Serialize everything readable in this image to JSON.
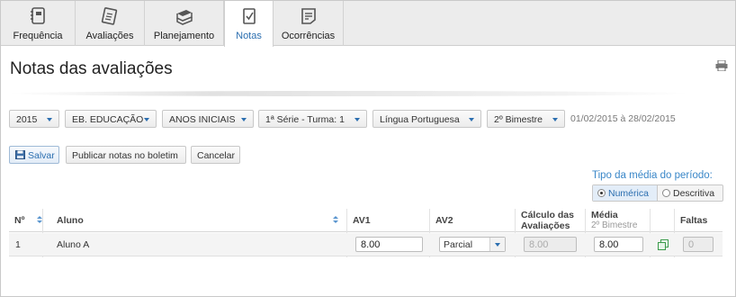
{
  "tabs": [
    {
      "label": "Frequência",
      "icon": "frequency-book-icon"
    },
    {
      "label": "Avaliações",
      "icon": "assessment-icon"
    },
    {
      "label": "Planejamento",
      "icon": "books-stack-icon"
    },
    {
      "label": "Notas",
      "icon": "grade-sheet-icon",
      "active": true
    },
    {
      "label": "Ocorrências",
      "icon": "occurrence-note-icon"
    }
  ],
  "page": {
    "title": "Notas das avaliações",
    "print_icon": "printer-icon"
  },
  "filters": {
    "year": "2015",
    "level": "EB. EDUCAÇÃO",
    "stage": "ANOS INICIAIS",
    "class": "1ª Série - Turma: 1",
    "subject": "Língua Portuguesa",
    "term": "2º Bimestre",
    "period": "01/02/2015 à 28/02/2015"
  },
  "actions": {
    "save": "Salvar",
    "publish": "Publicar notas no boletim",
    "cancel": "Cancelar"
  },
  "average_type": {
    "label": "Tipo da média do período:",
    "options": [
      "Numérica",
      "Descritiva"
    ],
    "selected": "Numérica"
  },
  "table": {
    "headers": {
      "num": "Nº",
      "student": "Aluno",
      "av1": "AV1",
      "av2": "AV2",
      "calc": "Cálculo das",
      "calc2": "Avaliações",
      "avg": "Média",
      "avg_sub": "2º Bimestre",
      "absences": "Faltas"
    },
    "rows": [
      {
        "num": "1",
        "student": "Aluno A",
        "av1": "8.00",
        "av2": "Parcial",
        "calc": "8.00",
        "avg": "8.00",
        "absences": "0"
      }
    ]
  },
  "colors": {
    "accent": "#2c6fb0",
    "label_blue": "#3a87c8"
  }
}
